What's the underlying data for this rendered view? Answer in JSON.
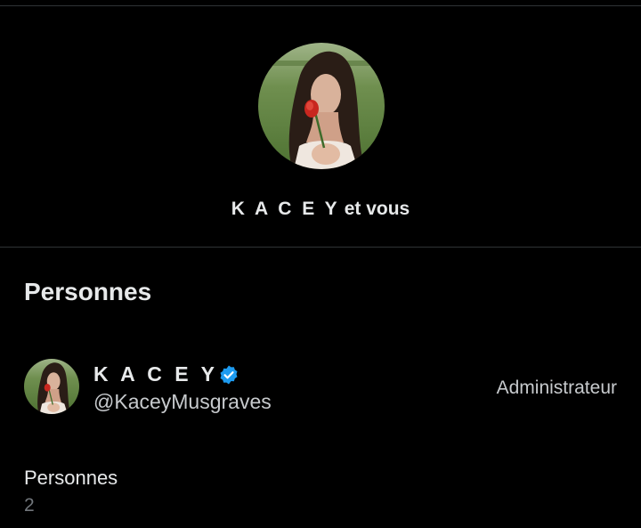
{
  "group": {
    "title_name": "K A C E Y",
    "title_suffix": "et vous"
  },
  "people_section": {
    "title": "Personnes"
  },
  "members": [
    {
      "display_name": "K A C E Y",
      "verified": true,
      "handle": "@KaceyMusgraves",
      "role": "Administrateur"
    }
  ],
  "people_count": {
    "label": "Personnes",
    "value": "2"
  },
  "icons": {
    "verified": "verified-badge-icon"
  },
  "colors": {
    "background": "#000000",
    "divider": "#2f3336",
    "primary_text": "#e7e9ea",
    "secondary_text": "#71767b",
    "verified": "#1d9bf0"
  }
}
